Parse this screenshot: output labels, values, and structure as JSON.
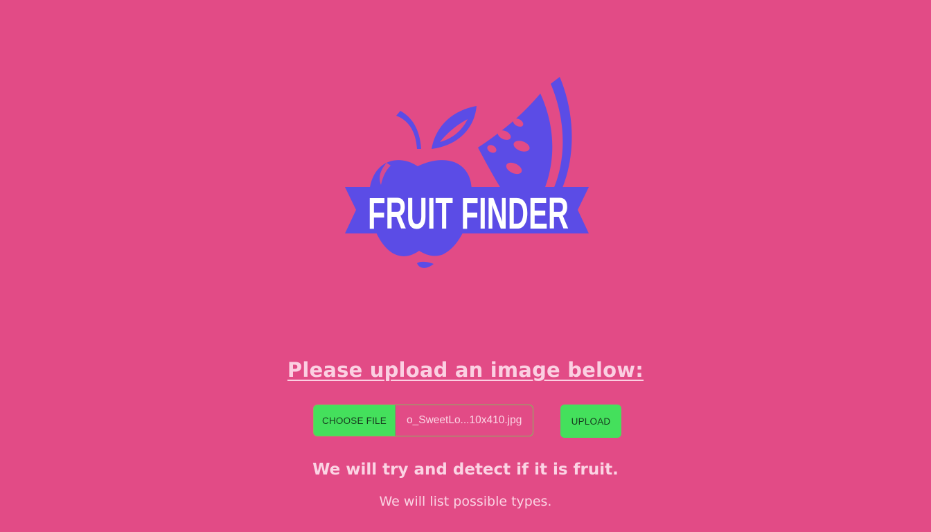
{
  "logo": {
    "text": "FRUIT FINDER",
    "icon": "fruit-finder-logo",
    "colors": {
      "primary": "#5b4ce6",
      "text": "#ffffff"
    }
  },
  "heading": "Please upload an image below:",
  "file_input": {
    "button_label": "CHOOSE FILE",
    "selected_file": "o_SweetLo...10x410.jpg"
  },
  "upload_button": {
    "label": "UPLOAD"
  },
  "info": {
    "detect": "We will try and detect if it is fruit.",
    "types": "We will list possible types."
  },
  "colors": {
    "background": "#e24b86",
    "accent": "#44e05c",
    "text": "#fbd4e4"
  }
}
